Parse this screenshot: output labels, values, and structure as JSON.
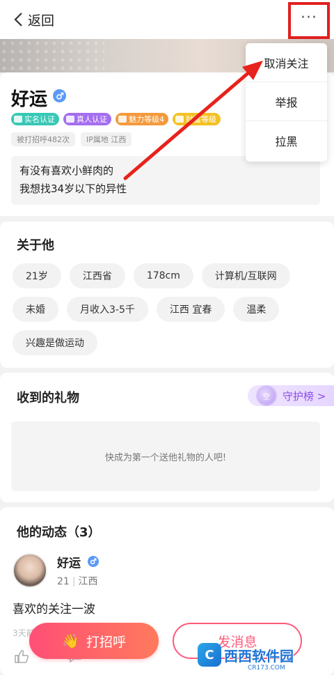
{
  "header": {
    "back_label": "返回",
    "more_label": "···"
  },
  "profile": {
    "name": "好运",
    "tags": [
      "实名认证",
      "真人认证",
      "魅力等级4",
      "财富等级"
    ],
    "stats": [
      "被打招呼482次",
      "IP属地 江西"
    ],
    "intro_lines": [
      "有没有喜欢小鲜肉的",
      "我想找34岁以下的异性"
    ]
  },
  "about": {
    "title": "关于他",
    "chips": [
      "21岁",
      "江西省",
      "178cm",
      "计算机/互联网",
      "未婚",
      "月收入3-5千",
      "江西 宜春",
      "温柔",
      "兴趣是做运动"
    ]
  },
  "gifts": {
    "title": "收到的礼物",
    "guard_label": "守护榜 >",
    "guard_badge": "空",
    "empty_text": "快成为第一个送他礼物的人吧!"
  },
  "feed": {
    "title": "他的动态（3）",
    "name": "好运",
    "age": "21",
    "location": "江西",
    "text": "喜欢的关注一波",
    "time": "3天前"
  },
  "actions": {
    "greet_label": "打招呼",
    "greet_icon": "👋",
    "message_label": "发消息"
  },
  "menu": {
    "items": [
      "取消关注",
      "举报",
      "拉黑"
    ]
  },
  "watermark": {
    "logo": "C",
    "text": "西西软件园",
    "sub": "CR173.COM"
  },
  "colors": {
    "highlight": "#e0201f",
    "arrow": "#e8221c",
    "accent": "#ff5a7a",
    "guard": "#8a4de6"
  }
}
